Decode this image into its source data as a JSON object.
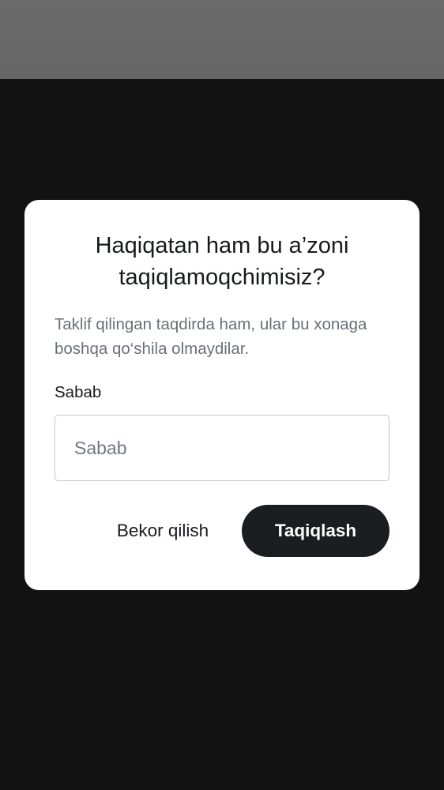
{
  "dialog": {
    "title": "Haqiqatan ham bu a’zoni taqiqlamoqchimisiz?",
    "description": "Taklif qilingan taqdirda ham, ular bu xonaga boshqa qo‘shila olmaydilar.",
    "reason_label": "Sabab",
    "reason_value": "",
    "reason_placeholder": "Sabab",
    "cancel_label": "Bekor qilish",
    "confirm_label": "Taqiqlash"
  },
  "colors": {
    "backdrop": "#121212",
    "dialog_background": "#ffffff",
    "primary_button": "#1b1d21",
    "secondary_text": "#6b6f76"
  }
}
